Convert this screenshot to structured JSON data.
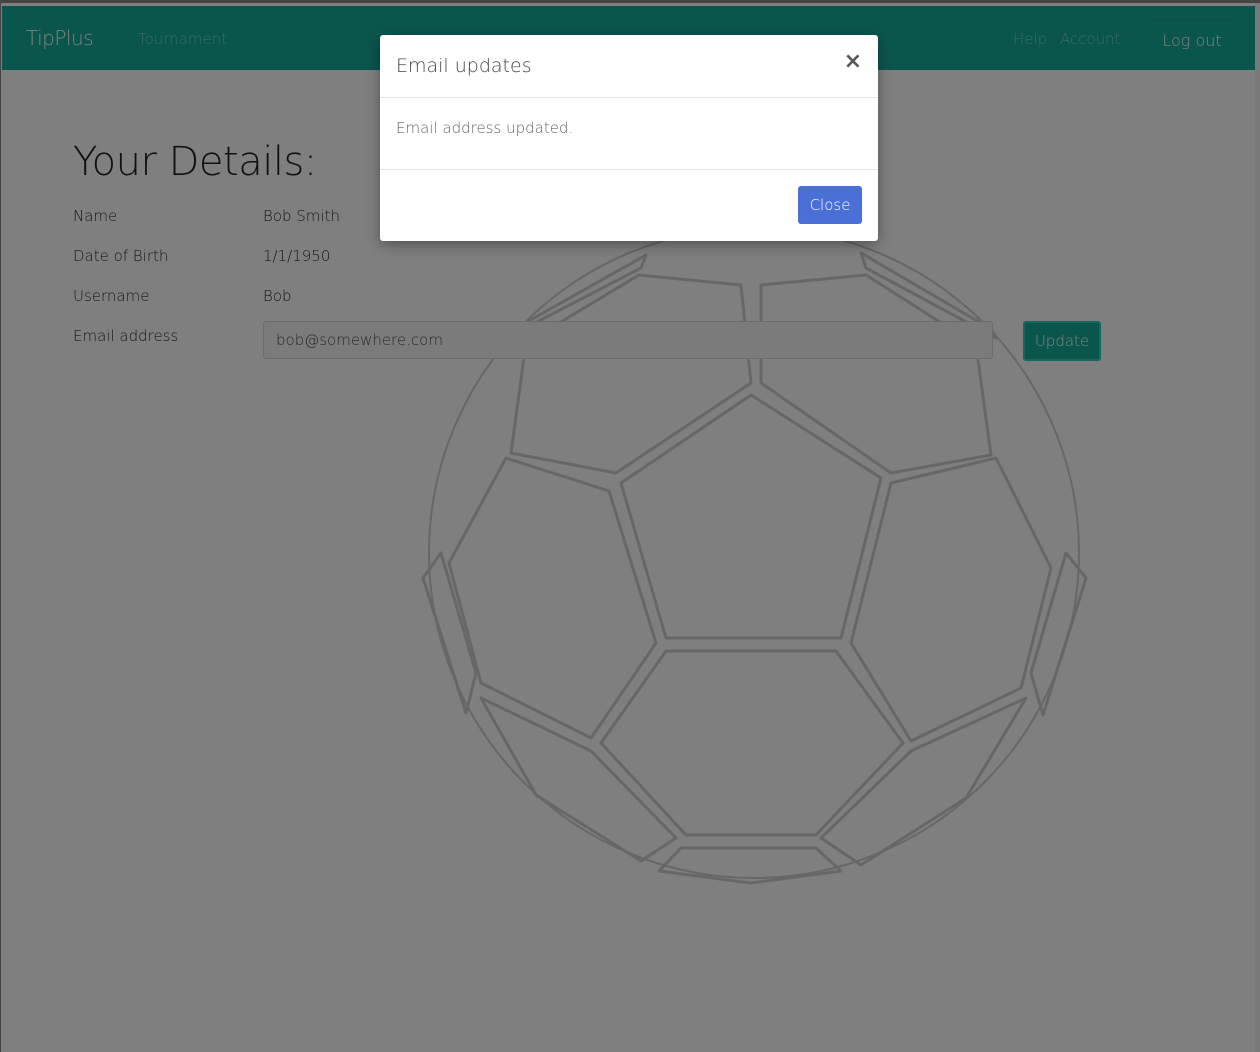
{
  "navbar": {
    "brand": "TipPlus",
    "links": {
      "tournament": "Tournament",
      "help": "Help",
      "account": "Account",
      "logout": "Log out"
    },
    "color": "#16ad99"
  },
  "details": {
    "title": "Your Details:",
    "rows": [
      {
        "label": "Name",
        "value": "Bob Smith"
      },
      {
        "label": "Date of Birth",
        "value": "1/1/1950"
      },
      {
        "label": "Username",
        "value": "Bob"
      },
      {
        "label": "Email address",
        "value": "bob@somewhere.com"
      }
    ],
    "update_label": "Update"
  },
  "modal": {
    "title": "Email updates",
    "close_x": "×",
    "message": "Email address updated.",
    "close_button": "Close",
    "button_color": "#4a70d6"
  },
  "background_graphic": "soccer-ball-icon"
}
